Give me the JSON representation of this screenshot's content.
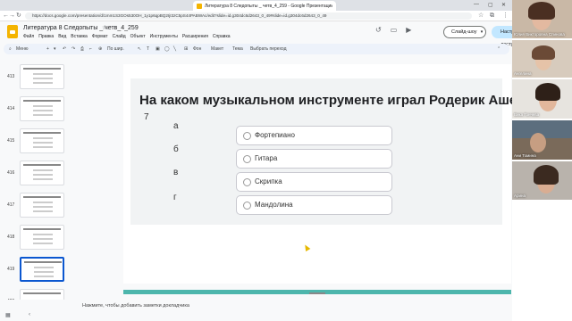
{
  "browser": {
    "tab_title": "Литература 8 Следопыты _ четв_4_259 - Google Презентации",
    "url": "https://docs.google.com/presentation/d/1mm1S3GOs530OH_1y1p6qpBQ2IjI3zC5pS44PABWAc/edit?slide=id.g304dc6d2643_0_49#slide=id.g304dc6d2643_0_49"
  },
  "doc": {
    "title": "Литература 8 Следопыты _ четв_4_259",
    "menus": [
      "Файл",
      "Правка",
      "Вид",
      "Вставка",
      "Формат",
      "Слайд",
      "Объект",
      "Инструменты",
      "Расширения",
      "Справка"
    ],
    "slideshow_label": "Слайд-шоу",
    "share_label": "Настройки доступа"
  },
  "toolbar": {
    "menu_label": "Меню",
    "zoom_label": "По шир.",
    "bg_label": "Фон",
    "layout_label": "Макет",
    "theme_label": "Тема",
    "transition_label": "Выбрать переход"
  },
  "filmstrip": {
    "slides": [
      {
        "num": "413",
        "selected": false
      },
      {
        "num": "414",
        "selected": false
      },
      {
        "num": "415",
        "selected": false
      },
      {
        "num": "416",
        "selected": false
      },
      {
        "num": "417",
        "selected": false
      },
      {
        "num": "418",
        "selected": false
      },
      {
        "num": "419",
        "selected": true
      },
      {
        "num": "420",
        "selected": false
      }
    ]
  },
  "slide": {
    "question": "На каком музыкальном инструменте играл Родерик Ашер?",
    "number": "7",
    "letters": [
      "а",
      "б",
      "в",
      "г"
    ],
    "options": [
      "Фортепиано",
      "Гитара",
      "Скрипка",
      "Мандолина"
    ]
  },
  "notes": {
    "placeholder": "Нажмите, чтобы добавить заметки докладчика"
  },
  "participants": [
    {
      "name": "Юлия Викторовна Спинова",
      "bg": "#c9b8a6"
    },
    {
      "name": "Ангелина",
      "bg": "#d7cbbd"
    },
    {
      "name": "Вика Гончева",
      "bg": "#e7e4df"
    },
    {
      "name": "Ани Томина",
      "bg": "#7a6a5a"
    },
    {
      "name": "Арина",
      "bg": "#b9b3ac"
    }
  ],
  "colors": {
    "accent": "#0b57d0",
    "share_bg": "#c2e7ff",
    "slide_footer": "#4db6ac",
    "card_bg": "#f1f3f4"
  }
}
